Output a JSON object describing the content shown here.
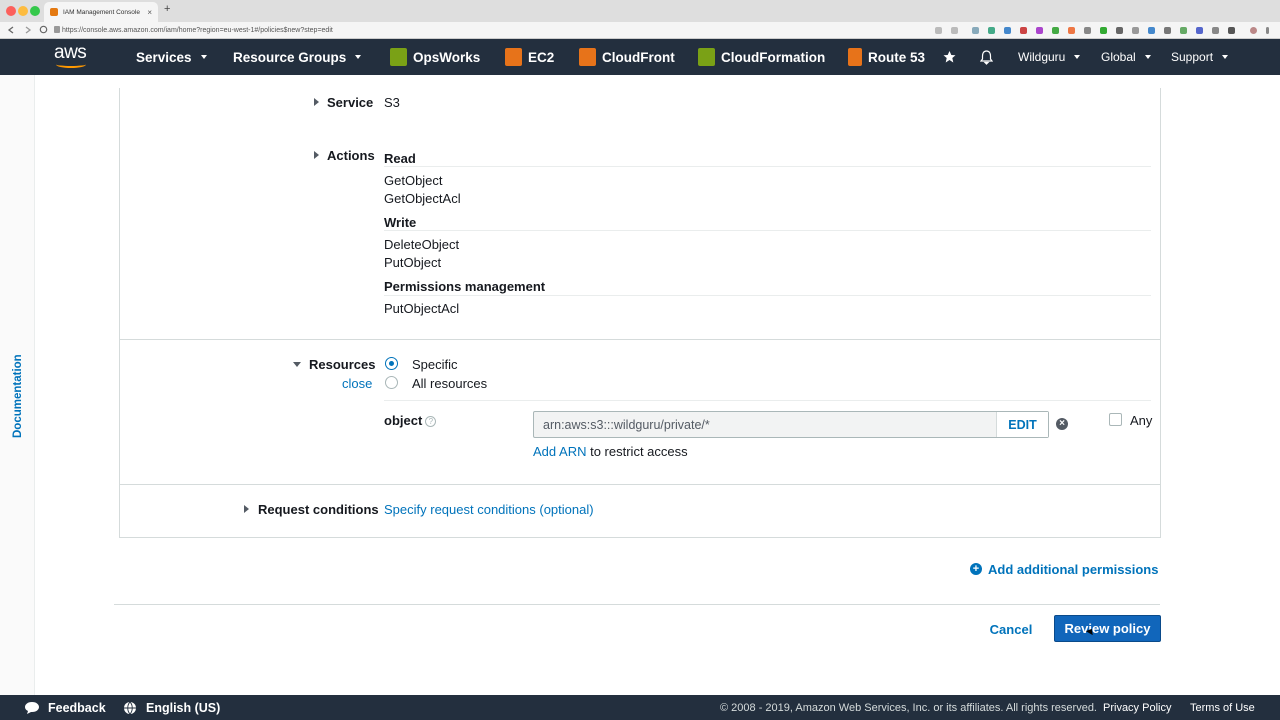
{
  "browser": {
    "tab_title": "IAM Management Console",
    "tab_close": "×",
    "new_tab": "+",
    "url": "https://console.aws.amazon.com/iam/home?region=eu-west-1#/policies$new?step=edit"
  },
  "nav": {
    "logo": "aws",
    "services": "Services",
    "resource_groups": "Resource Groups",
    "pinned": [
      {
        "label": "OpsWorks",
        "color": "#7aa116"
      },
      {
        "label": "EC2",
        "color": "#e7731a"
      },
      {
        "label": "CloudFront",
        "color": "#e7731a"
      },
      {
        "label": "CloudFormation",
        "color": "#7aa116"
      },
      {
        "label": "Route 53",
        "color": "#e7731a"
      }
    ],
    "account": "Wildguru",
    "region": "Global",
    "support": "Support"
  },
  "sidebar": {
    "documentation": "Documentation"
  },
  "policy": {
    "service_label": "Service",
    "service_value": "S3",
    "actions_label": "Actions",
    "action_groups": [
      {
        "name": "Read",
        "actions": [
          "GetObject",
          "GetObjectAcl"
        ]
      },
      {
        "name": "Write",
        "actions": [
          "DeleteObject",
          "PutObject"
        ]
      },
      {
        "name": "Permissions management",
        "actions": [
          "PutObjectAcl"
        ]
      }
    ],
    "resources_label": "Resources",
    "resources_close": "close",
    "resource_options": [
      "Specific",
      "All resources"
    ],
    "resource_selected": "Specific",
    "object_label": "object",
    "help_glyph": "?",
    "arn_value": "arn:aws:s3:::wildguru/private/*",
    "edit_label": "EDIT",
    "any_label": "Any",
    "add_arn_link": "Add ARN",
    "add_arn_suffix": " to restrict access",
    "request_conditions_label": "Request conditions",
    "request_conditions_link": "Specify request conditions (optional)"
  },
  "actions": {
    "add_permissions": "Add additional permissions",
    "cancel": "Cancel",
    "review": "Review policy"
  },
  "footer": {
    "feedback": "Feedback",
    "language": "English (US)",
    "copyright": "© 2008 - 2019, Amazon Web Services, Inc. or its affiliates. All rights reserved.",
    "privacy": "Privacy Policy",
    "terms": "Terms of Use"
  }
}
